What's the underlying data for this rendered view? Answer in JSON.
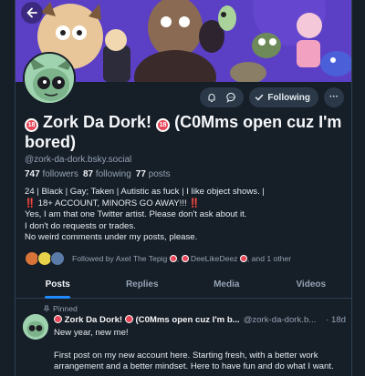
{
  "profile": {
    "display_name_main": "Zork Da Dork!",
    "display_name_tail": "(C0Mms open cuz I'm bored)",
    "handle": "@zork-da-dork.bsky.social",
    "badge_text": "18"
  },
  "actions": {
    "follow_label": "Following",
    "more_label": "···"
  },
  "stats": {
    "followers_count": "747",
    "followers_label": "followers",
    "following_count": "87",
    "following_label": "following",
    "posts_count": "77",
    "posts_label": "posts"
  },
  "bio": {
    "line1": "24 | Black | Gay; Taken | Autistic as fuck | I like object shows. |",
    "line2_prefix": "‼️",
    "line2_text": " 18+ ACCOUNT, MINORS GO AWAY!!! ",
    "line2_suffix": "‼️",
    "line3": "Yes, I am that one Twitter artist. Please don't ask about it.",
    "line4": "I don't do requests or trades.",
    "line5": "No weird comments under my posts, please."
  },
  "followed_by": {
    "prefix": "Followed by ",
    "user1": "Axel The Tepig",
    "sep": ", ",
    "user2": "DeeLikeDeez",
    "suffix": ", and 1 other"
  },
  "tabs": [
    {
      "label": "Posts"
    },
    {
      "label": "Replies"
    },
    {
      "label": "Media"
    },
    {
      "label": "Videos"
    }
  ],
  "post": {
    "pinned_label": "Pinned",
    "author_name": "Zork Da Dork!",
    "author_tail": "(C0Mms open cuz I'm b...",
    "author_handle": "@zork-da-dork.b...",
    "time": "· 18d",
    "line1": "New year, new me!",
    "line2": "First post on my new account here. Starting fresh, with a better work arrangement and a better mindset. Here to have fun and do what I want."
  },
  "colors": {
    "background": "#161e27",
    "accent": "#208bfe",
    "badge": "#e8475a",
    "banner": "#5a3dc0"
  }
}
